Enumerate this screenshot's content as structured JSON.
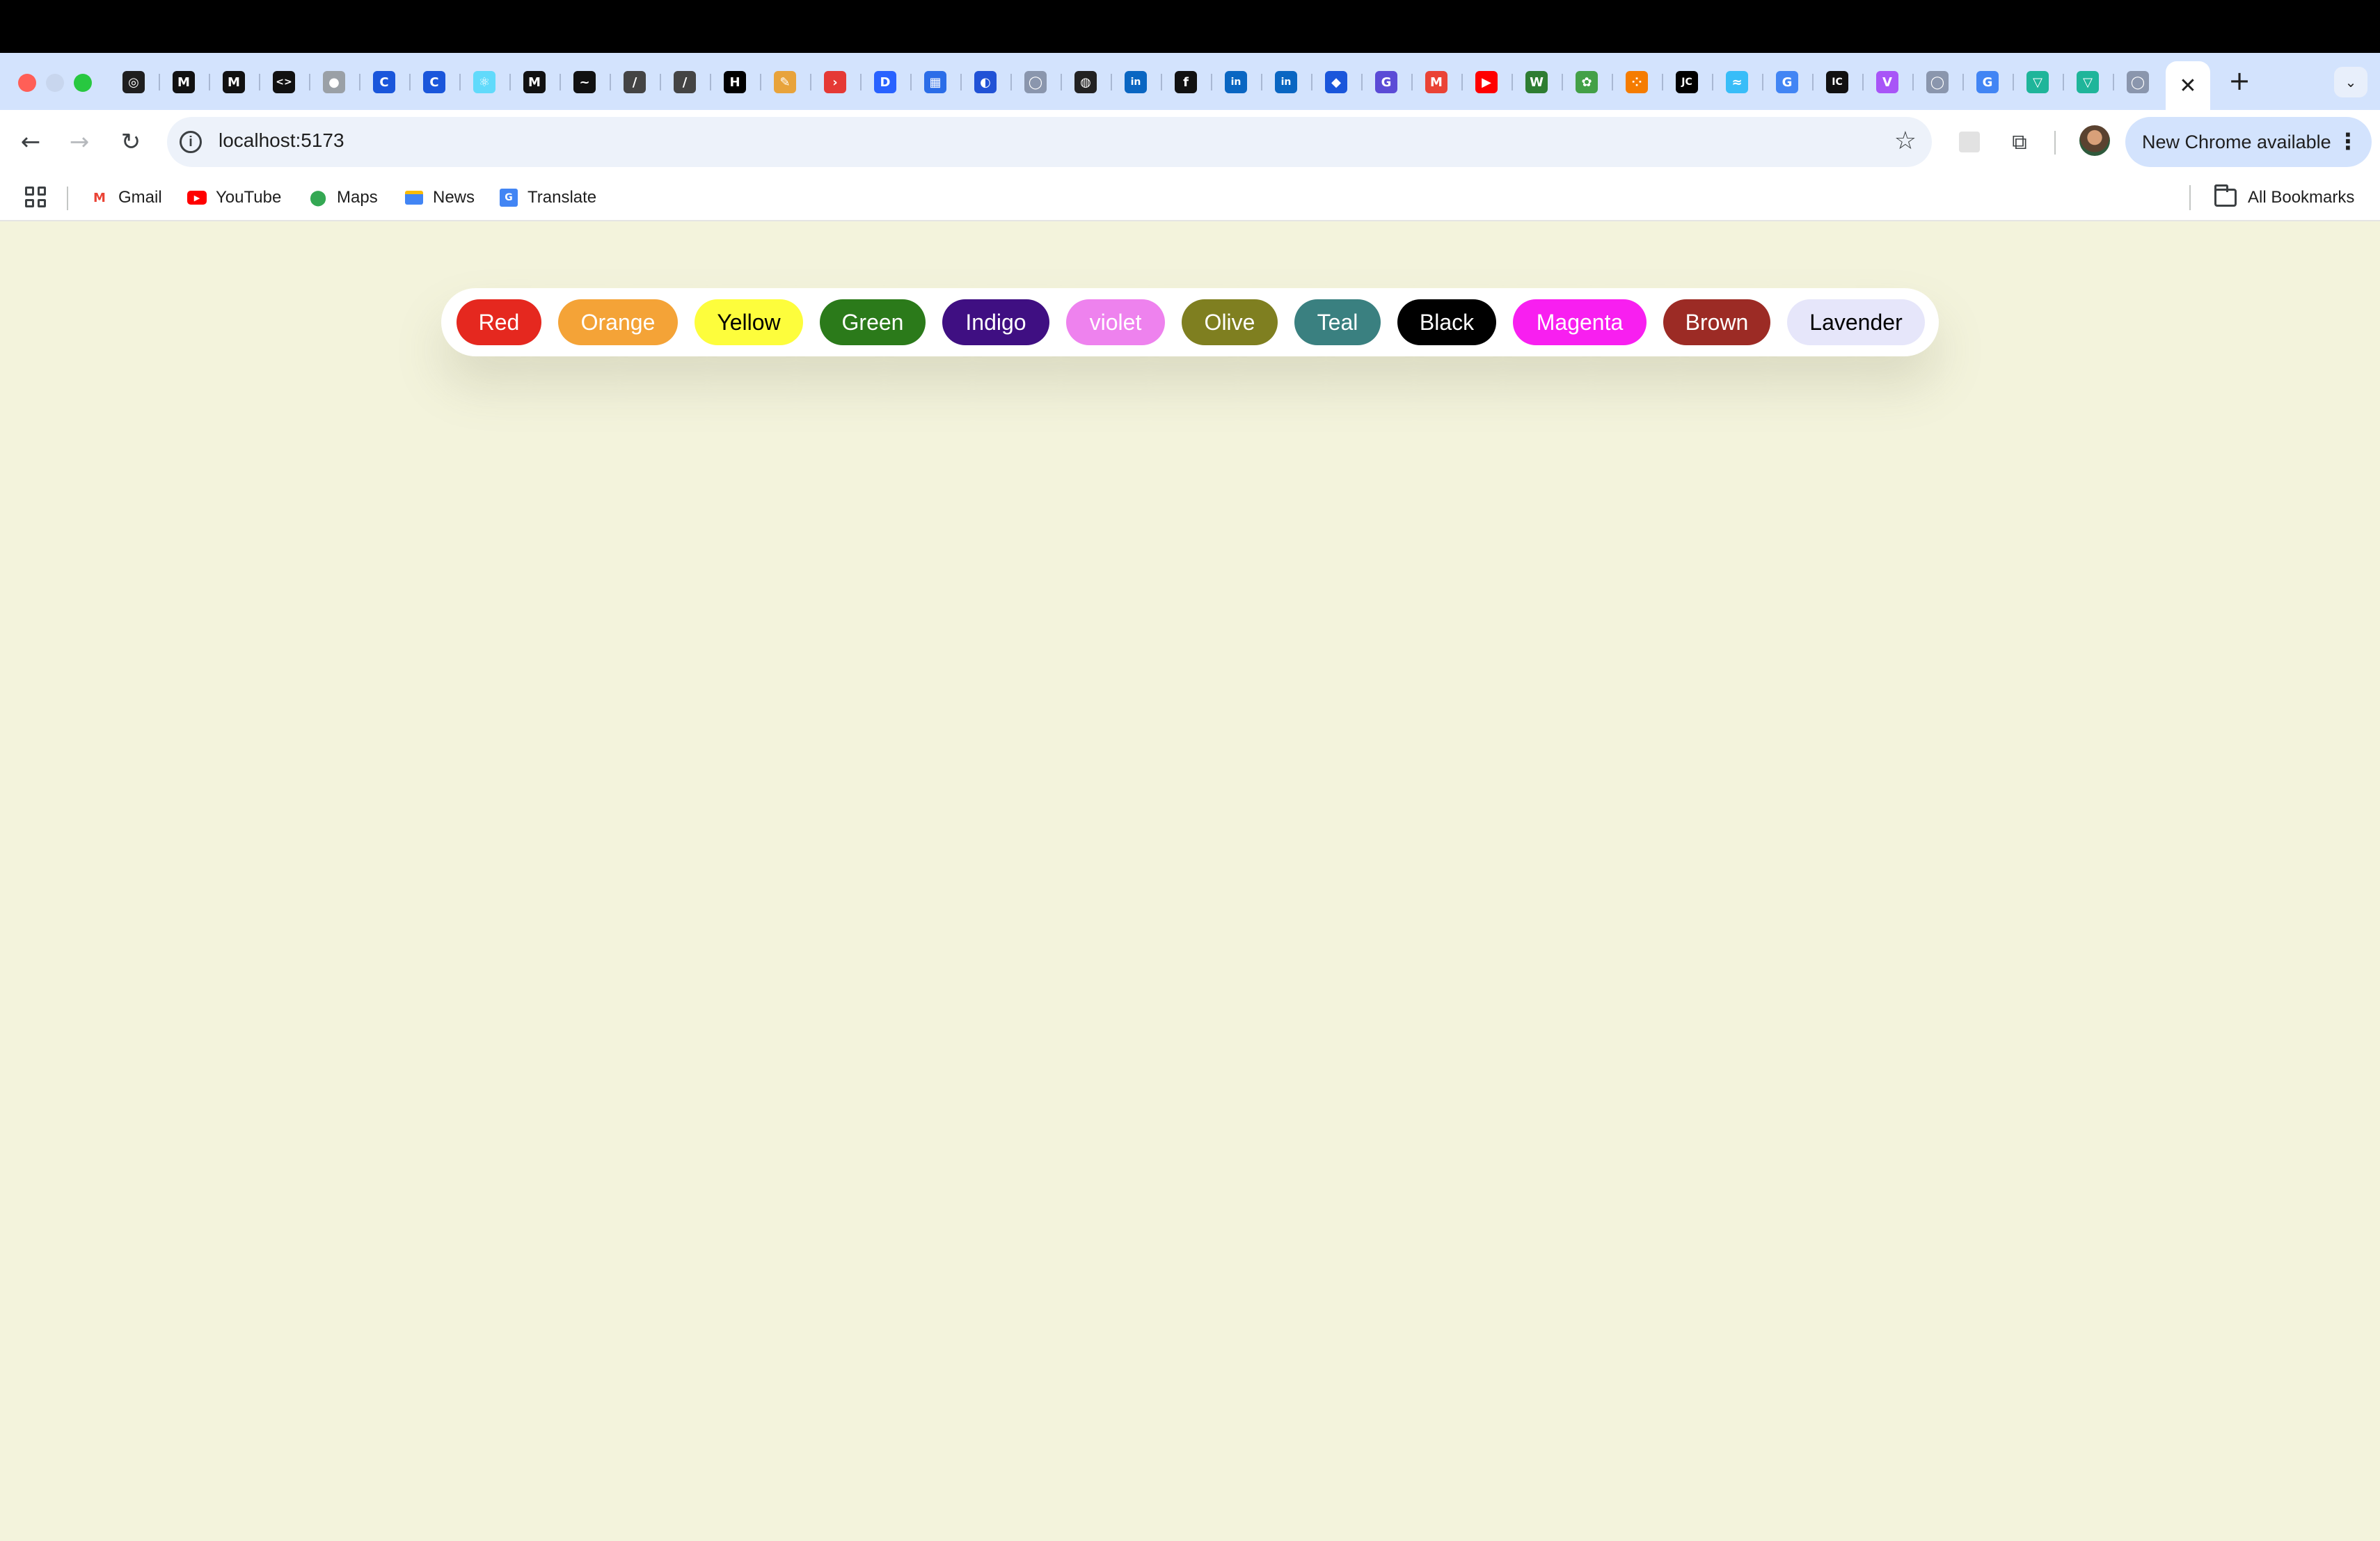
{
  "browser": {
    "tabs": [
      {
        "icon": "openai-icon",
        "glyph": "◎",
        "bg": "#1f1f1f"
      },
      {
        "icon": "medium-icon",
        "glyph": "M",
        "bg": "#111111"
      },
      {
        "icon": "medium-icon",
        "glyph": "M",
        "bg": "#111111"
      },
      {
        "icon": "code-icon",
        "glyph": "<>",
        "bg": "#111111"
      },
      {
        "icon": "globe-icon",
        "glyph": "●",
        "bg": "#9aa0a6"
      },
      {
        "icon": "c-icon",
        "glyph": "C",
        "bg": "#1a56db"
      },
      {
        "icon": "c-icon",
        "glyph": "C",
        "bg": "#1a56db"
      },
      {
        "icon": "react-icon",
        "glyph": "⚛",
        "bg": "#61dafb"
      },
      {
        "icon": "medium-icon",
        "glyph": "M",
        "bg": "#111111"
      },
      {
        "icon": "chart-icon",
        "glyph": "~",
        "bg": "#111111"
      },
      {
        "icon": "slash-icon",
        "glyph": "/",
        "bg": "#444444"
      },
      {
        "icon": "slash-icon",
        "glyph": "/",
        "bg": "#444444"
      },
      {
        "icon": "hashnode-icon",
        "glyph": "H",
        "bg": "#000000"
      },
      {
        "icon": "pen-icon",
        "glyph": "✎",
        "bg": "#e8a33b"
      },
      {
        "icon": "play-icon",
        "glyph": "›",
        "bg": "#e53935"
      },
      {
        "icon": "doc-icon",
        "glyph": "D",
        "bg": "#2962ff"
      },
      {
        "icon": "calendar-icon",
        "glyph": "▦",
        "bg": "#2b6de8"
      },
      {
        "icon": "compass-icon",
        "glyph": "◐",
        "bg": "#2152d6"
      },
      {
        "icon": "github-icon",
        "glyph": "◯",
        "bg": "#8a96ad"
      },
      {
        "icon": "ball-icon",
        "glyph": "◍",
        "bg": "#222222"
      },
      {
        "icon": "linkedin-icon",
        "glyph": "in",
        "bg": "#0a66c2"
      },
      {
        "icon": "fx-icon",
        "glyph": "f",
        "bg": "#111111"
      },
      {
        "icon": "linkedin-icon",
        "glyph": "in",
        "bg": "#0a66c2"
      },
      {
        "icon": "linkedin-icon",
        "glyph": "in",
        "bg": "#0a66c2"
      },
      {
        "icon": "diamond-icon",
        "glyph": "◆",
        "bg": "#1a56db"
      },
      {
        "icon": "g-icon",
        "glyph": "G",
        "bg": "#5b4bd6"
      },
      {
        "icon": "gmail-icon",
        "glyph": "M",
        "bg": "#ea4335"
      },
      {
        "icon": "youtube-icon",
        "glyph": "▶",
        "bg": "#ff0000"
      },
      {
        "icon": "w-icon",
        "glyph": "W",
        "bg": "#2e7d32"
      },
      {
        "icon": "leaf-icon",
        "glyph": "✿",
        "bg": "#43a047"
      },
      {
        "icon": "dots-icon",
        "glyph": "⁘",
        "bg": "#f57c00"
      },
      {
        "icon": "jc-icon",
        "glyph": "JC",
        "bg": "#000000"
      },
      {
        "icon": "tailwind-icon",
        "glyph": "≈",
        "bg": "#38bdf8"
      },
      {
        "icon": "google-icon",
        "glyph": "G",
        "bg": "#4285f4"
      },
      {
        "icon": "intellij-icon",
        "glyph": "IC",
        "bg": "#111111"
      },
      {
        "icon": "vite-icon",
        "glyph": "V",
        "bg": "#a855f7"
      },
      {
        "icon": "github-icon",
        "glyph": "◯",
        "bg": "#8a96ad"
      },
      {
        "icon": "google-icon",
        "glyph": "G",
        "bg": "#4285f4"
      },
      {
        "icon": "vuetify-icon",
        "glyph": "▽",
        "bg": "#1fb59a"
      },
      {
        "icon": "vuetify-icon",
        "glyph": "▽",
        "bg": "#1fb59a"
      },
      {
        "icon": "github-icon",
        "glyph": "◯",
        "bg": "#8a96ad"
      }
    ],
    "active_tab_close": "✕",
    "new_tab": "+",
    "tab_search": "⌄",
    "url": "localhost:5173",
    "update_label": "New Chrome available"
  },
  "bookmarks": {
    "items": [
      {
        "label": "Gmail",
        "icon": "gmail-icon"
      },
      {
        "label": "YouTube",
        "icon": "youtube-icon"
      },
      {
        "label": "Maps",
        "icon": "maps-icon"
      },
      {
        "label": "News",
        "icon": "news-icon"
      },
      {
        "label": "Translate",
        "icon": "translate-icon"
      }
    ],
    "all_bookmarks": "All Bookmarks"
  },
  "page": {
    "background": "#f3f3dc",
    "colors": [
      {
        "label": "Red",
        "bg": "#e5281f",
        "fg": "#ffffff"
      },
      {
        "label": "Orange",
        "bg": "#f4a337",
        "fg": "#ffffff"
      },
      {
        "label": "Yellow",
        "bg": "#fdfd3c",
        "fg": "#000000"
      },
      {
        "label": "Green",
        "bg": "#2b7a1a",
        "fg": "#ffffff"
      },
      {
        "label": "Indigo",
        "bg": "#3f0f82",
        "fg": "#ffffff"
      },
      {
        "label": "violet",
        "bg": "#ee82ee",
        "fg": "#ffffff"
      },
      {
        "label": "Olive",
        "bg": "#7f7f20",
        "fg": "#ffffff"
      },
      {
        "label": "Teal",
        "bg": "#3a8080",
        "fg": "#ffffff"
      },
      {
        "label": "Black",
        "bg": "#000000",
        "fg": "#ffffff"
      },
      {
        "label": "Magenta",
        "bg": "#f81ff0",
        "fg": "#ffffff"
      },
      {
        "label": "Brown",
        "bg": "#9c2b25",
        "fg": "#ffffff"
      },
      {
        "label": "Lavender",
        "bg": "#e6e6fa",
        "fg": "#000000"
      }
    ]
  }
}
